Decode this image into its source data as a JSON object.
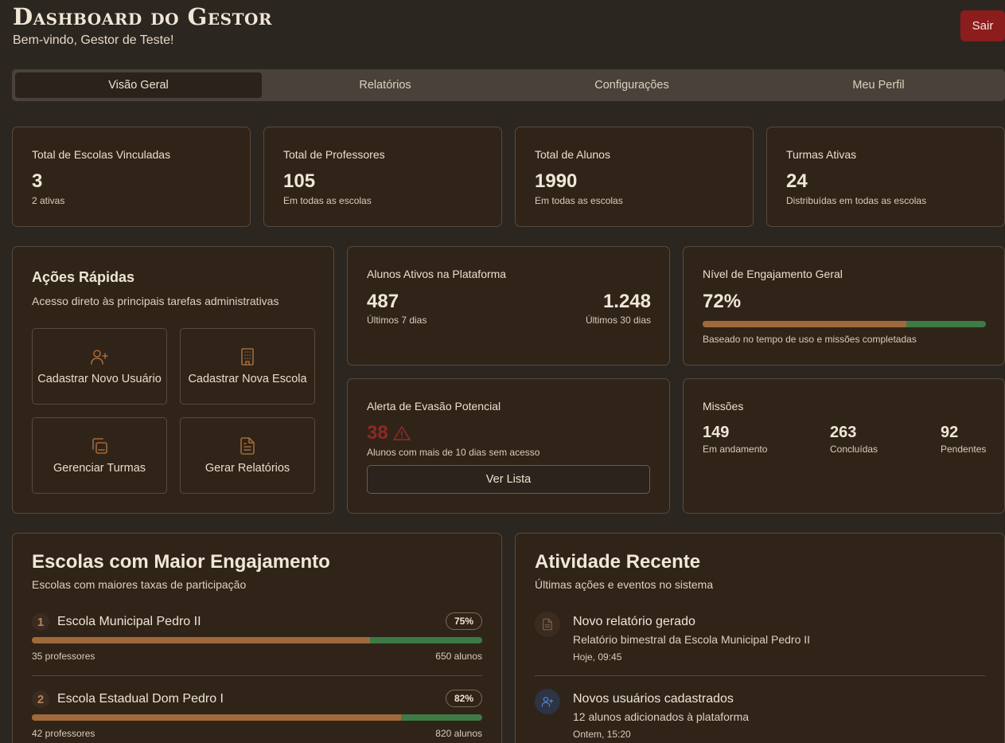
{
  "header": {
    "title": "Dashboard do Gestor",
    "welcome": "Bem-vindo, Gestor de Teste!",
    "logout_label": "Sair"
  },
  "tabs": [
    {
      "label": "Visão Geral",
      "active": true
    },
    {
      "label": "Relatórios",
      "active": false
    },
    {
      "label": "Configurações",
      "active": false
    },
    {
      "label": "Meu Perfil",
      "active": false
    }
  ],
  "stats": [
    {
      "label": "Total de Escolas Vinculadas",
      "value": "3",
      "sub": "2 ativas"
    },
    {
      "label": "Total de Professores",
      "value": "105",
      "sub": "Em todas as escolas"
    },
    {
      "label": "Total de Alunos",
      "value": "1990",
      "sub": "Em todas as escolas"
    },
    {
      "label": "Turmas Ativas",
      "value": "24",
      "sub": "Distribuídas em todas as escolas"
    }
  ],
  "quick_actions": {
    "title": "Ações Rápidas",
    "description": "Acesso direto às principais tarefas administrativas",
    "buttons": [
      {
        "label": "Cadastrar Novo Usuário",
        "icon": "user-plus-icon"
      },
      {
        "label": "Cadastrar Nova Escola",
        "icon": "building-icon"
      },
      {
        "label": "Gerenciar Turmas",
        "icon": "copy-icon"
      },
      {
        "label": "Gerar Relatórios",
        "icon": "file-text-icon"
      }
    ]
  },
  "active_students": {
    "label": "Alunos Ativos na Plataforma",
    "value_7d": "487",
    "sub_7d": "Últimos 7 dias",
    "value_30d": "1.248",
    "sub_30d": "Últimos 30 dias"
  },
  "engagement": {
    "label": "Nível de Engajamento Geral",
    "value": "72%",
    "level": 0.72,
    "sub": "Baseado no tempo de uso e missões completadas"
  },
  "dropout_alert": {
    "label": "Alerta de Evasão Potencial",
    "value": "38",
    "sub": "Alunos com mais de 10 dias sem acesso",
    "button": "Ver Lista",
    "icon": "warning-icon"
  },
  "missions": {
    "label": "Missões",
    "items": [
      {
        "value": "149",
        "sub": "Em andamento"
      },
      {
        "value": "263",
        "sub": "Concluídas"
      },
      {
        "value": "92",
        "sub": "Pendentes"
      }
    ]
  },
  "top_schools": {
    "title": "Escolas com Maior Engajamento",
    "description": "Escolas com maiores taxas de participação",
    "items": [
      {
        "rank": "1",
        "name": "Escola Municipal Pedro II",
        "pct": "75%",
        "level": 0.75,
        "teachers": "35 professores",
        "students": "650 alunos"
      },
      {
        "rank": "2",
        "name": "Escola Estadual Dom Pedro I",
        "pct": "82%",
        "level": 0.82,
        "teachers": "42 professores",
        "students": "820 alunos"
      }
    ]
  },
  "recent_activity": {
    "title": "Atividade Recente",
    "description": "Últimas ações e eventos no sistema",
    "items": [
      {
        "icon": "file-text-icon",
        "title": "Novo relatório gerado",
        "desc": "Relatório bimestral da Escola Municipal Pedro II",
        "time": "Hoje, 09:45"
      },
      {
        "icon": "user-plus-icon",
        "title": "Novos usuários cadastrados",
        "desc": "12 alunos adicionados à plataforma",
        "time": "Ontem, 15:20"
      }
    ]
  },
  "colors": {
    "background": "#2c2621",
    "card": "#302419",
    "accent_brown": "#a1693b",
    "accent_green": "#3d7a45",
    "alert_red": "#8b1d1d"
  }
}
